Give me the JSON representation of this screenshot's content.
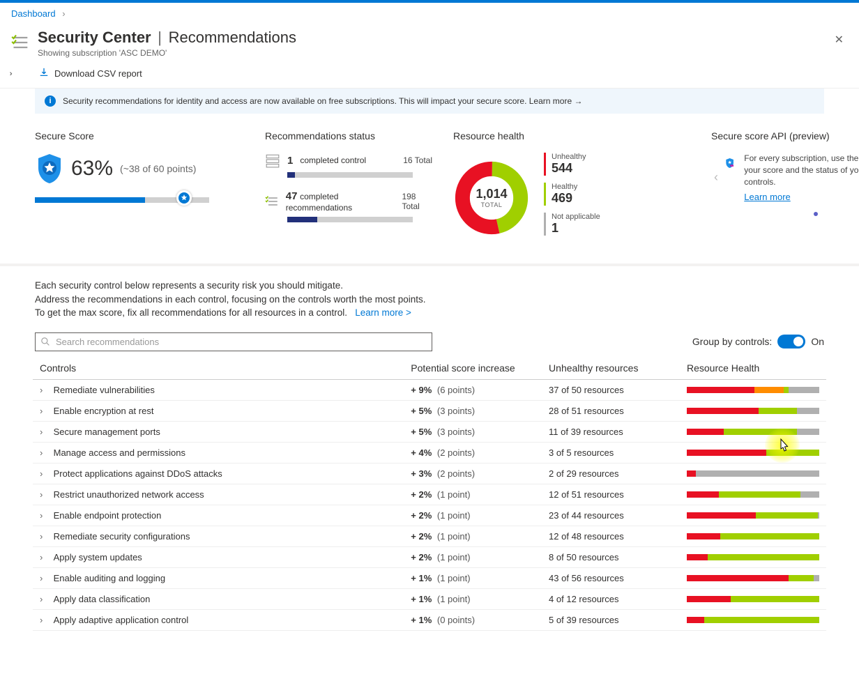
{
  "breadcrumb": {
    "dashboard": "Dashboard"
  },
  "header": {
    "title": "Security Center",
    "section": "Recommendations",
    "subtitle": "Showing subscription 'ASC DEMO'"
  },
  "toolbar": {
    "download": "Download CSV report"
  },
  "infobar": {
    "text": "Security recommendations for identity and access are now available on free subscriptions. This will impact your secure score. Learn more →"
  },
  "secureScore": {
    "label": "Secure Score",
    "percent": "63%",
    "sub": "(~38 of 60 points)",
    "bar_pct": 83
  },
  "recStatus": {
    "label": "Recommendations status",
    "controls_num": "1",
    "controls_text": "completed control",
    "controls_total": "16 Total",
    "controls_bar": 6,
    "recs_num": "47",
    "recs_text": "completed recommendations",
    "recs_total": "198 Total",
    "recs_bar": 24
  },
  "resourceHealth": {
    "label": "Resource health",
    "total": "1,014",
    "total_label": "TOTAL",
    "unhealthy_label": "Unhealthy",
    "unhealthy": "544",
    "healthy_label": "Healthy",
    "healthy": "469",
    "na_label": "Not applicable",
    "na": "1"
  },
  "api": {
    "label": "Secure score API (preview)",
    "text": "For every subscription, use the API to get your score and the status of your security controls.",
    "link": "Learn more"
  },
  "intro": {
    "l1": "Each security control below represents a security risk you should mitigate.",
    "l2": "Address the recommendations in each control, focusing on the controls worth the most points.",
    "l3": "To get the max score, fix all recommendations for all resources in a control.",
    "learn": "Learn more >"
  },
  "search": {
    "placeholder": "Search recommendations"
  },
  "groupBy": {
    "label": "Group by controls:",
    "state": "On"
  },
  "tableHeaders": {
    "controls": "Controls",
    "psi": "Potential score increase",
    "unhealthy": "Unhealthy resources",
    "health": "Resource Health"
  },
  "rows": [
    {
      "name": "Remediate vulnerabilities",
      "pct": "+ 9%",
      "pts": "(6 points)",
      "un": "37 of 50 resources",
      "bar": {
        "r": 51,
        "o": 22,
        "g": 4,
        "b": 23
      }
    },
    {
      "name": "Enable encryption at rest",
      "pct": "+ 5%",
      "pts": "(3 points)",
      "un": "28 of 51 resources",
      "bar": {
        "r": 54,
        "o": 0,
        "g": 29,
        "b": 17
      }
    },
    {
      "name": "Secure management ports",
      "pct": "+ 5%",
      "pts": "(3 points)",
      "un": "11 of 39 resources",
      "bar": {
        "r": 28,
        "o": 0,
        "g": 55,
        "b": 17
      }
    },
    {
      "name": "Manage access and permissions",
      "pct": "+ 4%",
      "pts": "(2 points)",
      "un": "3 of 5 resources",
      "bar": {
        "r": 60,
        "o": 0,
        "g": 40,
        "b": 0
      }
    },
    {
      "name": "Protect applications against DDoS attacks",
      "pct": "+ 3%",
      "pts": "(2 points)",
      "un": "2 of 29 resources",
      "bar": {
        "r": 7,
        "o": 0,
        "g": 0,
        "b": 93
      }
    },
    {
      "name": "Restrict unauthorized network access",
      "pct": "+ 2%",
      "pts": "(1 point)",
      "un": "12 of 51 resources",
      "bar": {
        "r": 24,
        "o": 0,
        "g": 62,
        "b": 14
      }
    },
    {
      "name": "Enable endpoint protection",
      "pct": "+ 2%",
      "pts": "(1 point)",
      "un": "23 of 44 resources",
      "bar": {
        "r": 52,
        "o": 0,
        "g": 47,
        "b": 1
      }
    },
    {
      "name": "Remediate security configurations",
      "pct": "+ 2%",
      "pts": "(1 point)",
      "un": "12 of 48 resources",
      "bar": {
        "r": 25,
        "o": 0,
        "g": 75,
        "b": 0
      }
    },
    {
      "name": "Apply system updates",
      "pct": "+ 2%",
      "pts": "(1 point)",
      "un": "8 of 50 resources",
      "bar": {
        "r": 16,
        "o": 0,
        "g": 84,
        "b": 0
      }
    },
    {
      "name": "Enable auditing and logging",
      "pct": "+ 1%",
      "pts": "(1 point)",
      "un": "43 of 56 resources",
      "bar": {
        "r": 77,
        "o": 0,
        "g": 19,
        "b": 4
      }
    },
    {
      "name": "Apply data classification",
      "pct": "+ 1%",
      "pts": "(1 point)",
      "un": "4 of 12 resources",
      "bar": {
        "r": 33,
        "o": 0,
        "g": 67,
        "b": 0
      }
    },
    {
      "name": "Apply adaptive application control",
      "pct": "+ 1%",
      "pts": "(0 points)",
      "un": "5 of 39 resources",
      "bar": {
        "r": 13,
        "o": 0,
        "g": 87,
        "b": 0
      }
    }
  ]
}
